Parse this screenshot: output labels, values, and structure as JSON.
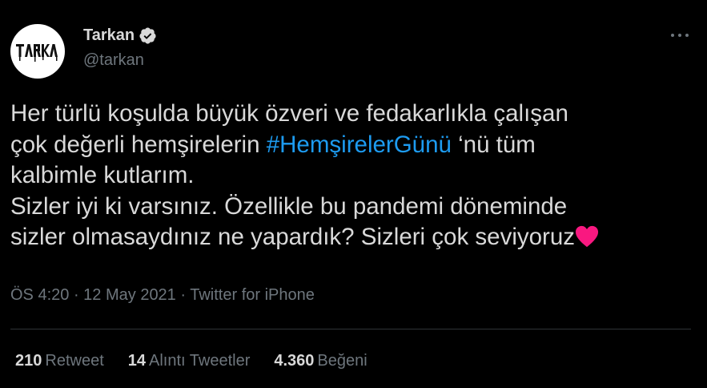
{
  "author": {
    "display_name": "Tarkan",
    "handle": "@tarkan",
    "verified": true,
    "avatar_icon": "tarkan-logo-avatar"
  },
  "tweet": {
    "text_line1": "Her türlü koşulda büyük özveri ve fedakarlıkla çalışan",
    "text_line2_before": "çok değerli hemşirelerin ",
    "hashtag": "#HemşirelerGünü",
    "text_line2_after": " ‘nü tüm",
    "text_line3": "kalbimle kutlarım.",
    "text_line4": "Sizler iyi ki varsınız. Özellikle bu pandemi döneminde",
    "text_line5": "sizler olmasaydınız ne yapardık? Sizleri çok seviyoruz",
    "emoji_icon": "red-heart-icon"
  },
  "meta": {
    "time": "ÖS 4:20",
    "separator": " · ",
    "date": "12 May 2021",
    "source": "Twitter for iPhone"
  },
  "stats": {
    "retweets_count": "210",
    "retweets_label": "Retweet",
    "quotes_count": "14",
    "quotes_label": "Alıntı Tweetler",
    "likes_count": "4.360",
    "likes_label": "Beğeni"
  },
  "colors": {
    "background": "#000000",
    "text": "#d9d9d9",
    "secondary": "#6e767d",
    "link": "#1d9bf0",
    "heart": "#f91880"
  }
}
